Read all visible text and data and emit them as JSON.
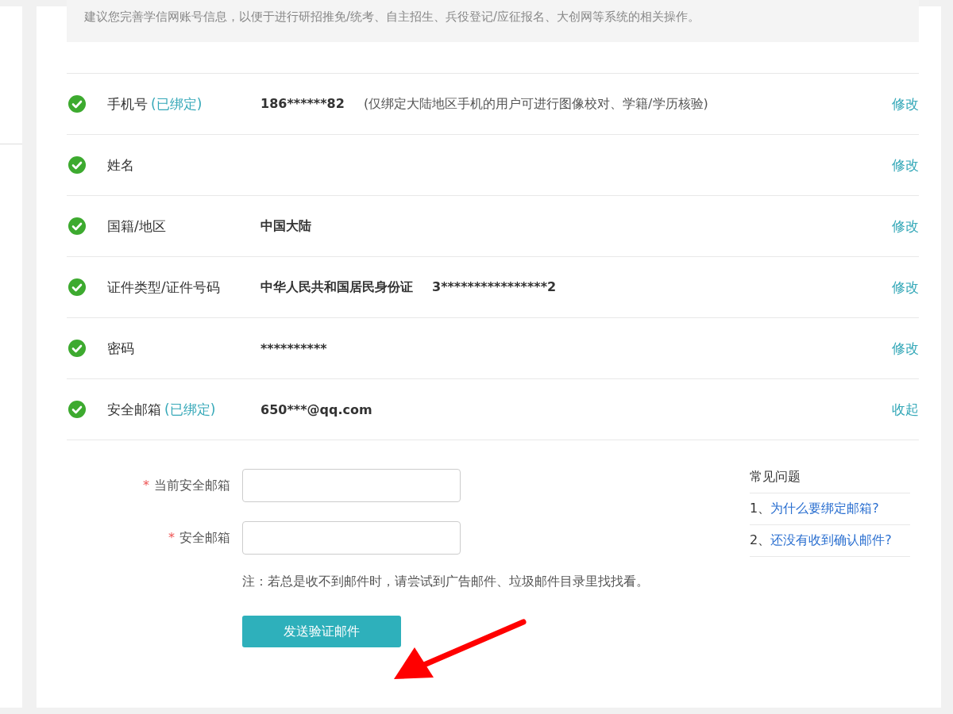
{
  "notice": "建议您完善学信网账号信息，以便于进行研招推免/统考、自主招生、兵役登记/应征报名、大创网等系统的相关操作。",
  "rows": [
    {
      "verified": true,
      "label": "手机号",
      "tag": "(已绑定)",
      "values": [
        "186******82"
      ],
      "note": "(仅绑定大陆地区手机的用户可进行图像校对、学籍/学历核验)",
      "action": "修改"
    },
    {
      "verified": true,
      "label": "姓名",
      "values": [],
      "action": "修改"
    },
    {
      "verified": true,
      "label": "国籍/地区",
      "values": [
        "中国大陆"
      ],
      "action": "修改"
    },
    {
      "verified": true,
      "label": "证件类型/证件号码",
      "values": [
        "中华人民共和国居民身份证",
        "3****************2"
      ],
      "action": "修改"
    },
    {
      "verified": true,
      "label": "密码",
      "values": [
        "**********"
      ],
      "action": "修改"
    },
    {
      "verified": true,
      "label": "安全邮箱",
      "tag": "(已绑定)",
      "values": [
        "650***@qq.com"
      ],
      "action": "收起"
    }
  ],
  "form": {
    "fields": [
      {
        "required": true,
        "mark": "*",
        "label": "当前安全邮箱"
      },
      {
        "required": true,
        "mark": "*",
        "label": "安全邮箱"
      }
    ],
    "note": "注：若总是收不到邮件时，请尝试到广告邮件、垃圾邮件目录里找找看。",
    "button": "发送验证邮件"
  },
  "faq": {
    "title": "常见问题",
    "items": [
      {
        "num": "1、",
        "text": "为什么要绑定邮箱?"
      },
      {
        "num": "2、",
        "text": "还没有收到确认邮件?"
      }
    ]
  }
}
